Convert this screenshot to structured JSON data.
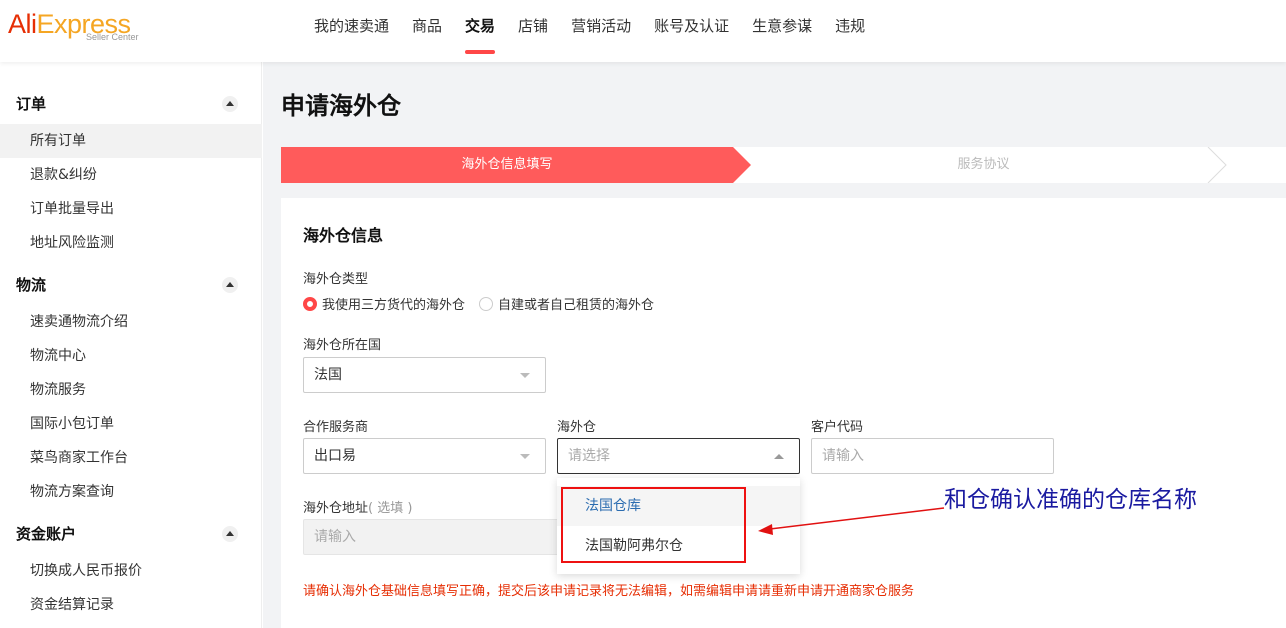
{
  "header": {
    "logo": {
      "brand_part1": "Ali",
      "brand_part2": "Express",
      "subtitle": "Seller Center"
    },
    "nav": [
      "我的速卖通",
      "商品",
      "交易",
      "店铺",
      "营销活动",
      "账号及认证",
      "生意参谋",
      "违规"
    ],
    "active_nav": "交易"
  },
  "sidebar": {
    "groups": [
      {
        "title": "订单",
        "items": [
          "所有订单",
          "退款&纠纷",
          "订单批量导出",
          "地址风险监测"
        ]
      },
      {
        "title": "物流",
        "items": [
          "速卖通物流介绍",
          "物流中心",
          "物流服务",
          "国际小包订单",
          "菜鸟商家工作台",
          "物流方案查询"
        ]
      },
      {
        "title": "资金账户",
        "items": [
          "切换成人民币报价",
          "资金结算记录"
        ]
      }
    ],
    "active_item": "所有订单"
  },
  "main": {
    "title": "申请海外仓",
    "steps": [
      "海外仓信息填写",
      "服务协议"
    ],
    "section_title": "海外仓信息",
    "warehouse_type": {
      "label": "海外仓类型",
      "options": [
        "我使用三方货代的海外仓",
        "自建或者自己租赁的海外仓"
      ],
      "selected": "我使用三方货代的海外仓"
    },
    "country": {
      "label": "海外仓所在国",
      "value": "法国"
    },
    "provider": {
      "label": "合作服务商",
      "value": "出口易"
    },
    "warehouse": {
      "label": "海外仓",
      "placeholder": "请选择",
      "options": [
        "法国仓库",
        "法国勒阿弗尔仓"
      ]
    },
    "customer_code": {
      "label": "客户代码",
      "placeholder": "请输入"
    },
    "address": {
      "label": "海外仓地址",
      "optional": "( 选填 )",
      "placeholder": "请输入"
    },
    "warning": "请确认海外仓基础信息填写正确，提交后该申请记录将无法编辑，如需编辑申请请重新申请开通商家仓服务"
  },
  "annotation": {
    "text": "和仓确认准确的仓库名称",
    "color": "#e11111"
  },
  "colors": {
    "accent": "#ff4747",
    "step_active": "#ff5b5b",
    "warning": "#e62e04",
    "annotation_text": "#1a1aa0"
  }
}
